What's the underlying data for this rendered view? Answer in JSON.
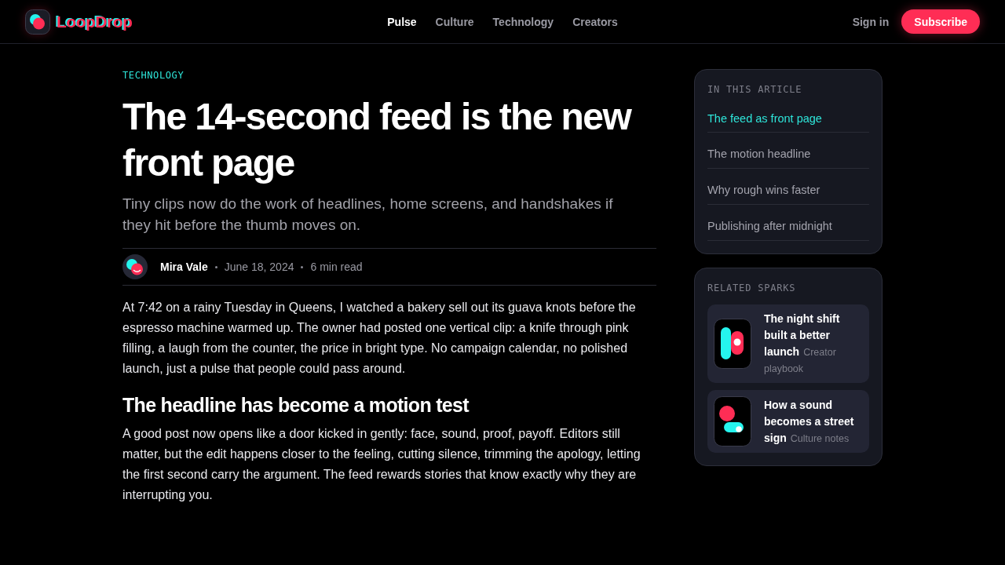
{
  "header": {
    "logo": {
      "text": "LoopDrop"
    },
    "nav": [
      {
        "label": "Pulse",
        "selected": true
      },
      {
        "label": "Culture",
        "selected": false
      },
      {
        "label": "Technology",
        "selected": false
      },
      {
        "label": "Creators",
        "selected": false
      }
    ],
    "sign_in": "Sign in",
    "subscribe": "Subscribe"
  },
  "article": {
    "kicker": "TECHNOLOGY",
    "title": "The 14-second feed is the new front page",
    "subtitle": "Tiny clips now do the work of headlines, home screens, and handshakes if they hit before the thumb moves on.",
    "author": {
      "name": "Mira Vale",
      "date": "June 18, 2024",
      "read_time": "6 min read"
    },
    "body": [
      {
        "kind": "paragraph",
        "text": "At 7:42 on a rainy Tuesday in Queens, I watched a bakery sell out its guava knots before the espresso machine warmed up. The owner had posted one vertical clip: a knife through pink filling, a laugh from the counter, the price in bright type. No campaign calendar, no polished launch, just a pulse that people could pass around."
      },
      {
        "kind": "heading",
        "text": "The headline has become a motion test"
      },
      {
        "kind": "paragraph",
        "text": "A good post now opens like a door kicked in gently: face, sound, proof, payoff. Editors still matter, but the edit happens closer to the feeling, cutting silence, trimming the apology, letting the first second carry the argument. The feed rewards stories that know exactly why they are interrupting you."
      }
    ]
  },
  "toc": {
    "heading": "IN THIS ARTICLE",
    "items": [
      {
        "label": "The feed as front page",
        "selected": true
      },
      {
        "label": "The motion headline",
        "selected": false
      },
      {
        "label": "Why rough wins faster",
        "selected": false
      },
      {
        "label": "Publishing after midnight",
        "selected": false
      }
    ]
  },
  "related": {
    "heading": "RELATED SPARKS",
    "items": [
      {
        "kind": "bars",
        "title": "The night shift built a better launch",
        "category": "Creator playbook"
      },
      {
        "kind": "dot-pill",
        "title": "How a sound becomes a street sign",
        "category": "Culture notes"
      }
    ]
  }
}
